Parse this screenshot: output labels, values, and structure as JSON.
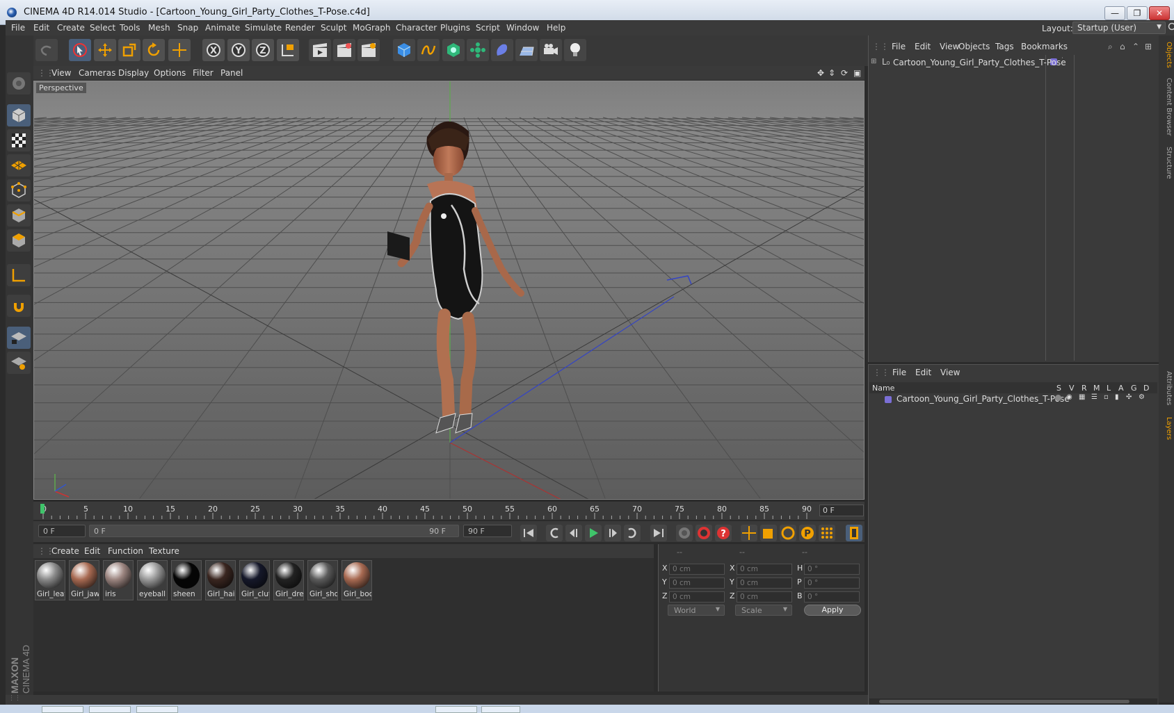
{
  "window": {
    "title": "CINEMA 4D R14.014 Studio - [Cartoon_Young_Girl_Party_Clothes_T-Pose.c4d]",
    "min_label": "—",
    "max_label": "❐",
    "close_label": "✕"
  },
  "menu": [
    "File",
    "Edit",
    "Create",
    "Select",
    "Tools",
    "Mesh",
    "Snap",
    "Animate",
    "Simulate",
    "Render",
    "Sculpt",
    "MoGraph",
    "Character",
    "Plugins",
    "Script",
    "Window",
    "Help"
  ],
  "layout": {
    "label": "Layout:",
    "value": "Startup (User)"
  },
  "viewport": {
    "menu": [
      "View",
      "Cameras",
      "Display",
      "Options",
      "Filter",
      "Panel"
    ],
    "label": "Perspective"
  },
  "timeline": {
    "ticks": [
      "0",
      "5",
      "10",
      "15",
      "20",
      "25",
      "30",
      "35",
      "40",
      "45",
      "50",
      "55",
      "60",
      "65",
      "70",
      "75",
      "80",
      "85",
      "90"
    ],
    "current": "0 F"
  },
  "transport": {
    "start": "0 F",
    "range_start": "0 F",
    "range_end": "90 F",
    "end": "90 F"
  },
  "materials": {
    "menu": [
      "Create",
      "Edit",
      "Function",
      "Texture"
    ],
    "items": [
      {
        "name": "Girl_leat",
        "color": "#8a8a8a"
      },
      {
        "name": "Girl_jaw",
        "color": "#a86a52"
      },
      {
        "name": "iris",
        "color": "#9c8580"
      },
      {
        "name": "eyeball",
        "color": "#9a9a9a"
      },
      {
        "name": "sheen",
        "color": "#050505"
      },
      {
        "name": "Girl_hair",
        "color": "#3a2620"
      },
      {
        "name": "Girl_clut",
        "color": "#15182a"
      },
      {
        "name": "Girl_dre",
        "color": "#222"
      },
      {
        "name": "Girl_sho",
        "color": "#5b5b5b"
      },
      {
        "name": "Girl_boc",
        "color": "#a86a52"
      }
    ]
  },
  "coords": {
    "headers": [
      "--",
      "--",
      "--"
    ],
    "rows": [
      {
        "a": "X",
        "av": "0 cm",
        "b": "X",
        "bv": "0 cm",
        "c": "H",
        "cv": "0 °"
      },
      {
        "a": "Y",
        "av": "0 cm",
        "b": "Y",
        "bv": "0 cm",
        "c": "P",
        "cv": "0 °"
      },
      {
        "a": "Z",
        "av": "0 cm",
        "b": "Z",
        "bv": "0 cm",
        "c": "B",
        "cv": "0 °"
      }
    ],
    "world": "World",
    "scale": "Scale",
    "apply": "Apply"
  },
  "objects": {
    "menu": [
      "File",
      "Edit",
      "View",
      "Objects",
      "Tags",
      "Bookmarks"
    ],
    "item": "Cartoon_Young_Girl_Party_Clothes_T-Pose"
  },
  "layers": {
    "menu": [
      "File",
      "Edit",
      "View"
    ],
    "name_header": "Name",
    "cols": [
      "S",
      "V",
      "R",
      "M",
      "L",
      "A",
      "G",
      "D"
    ],
    "item": "Cartoon_Young_Girl_Party_Clothes_T-Pose"
  },
  "sidetabs": [
    "Objects",
    "Content Browser",
    "Structure",
    "Attributes",
    "Layers"
  ],
  "brand": {
    "maxon": "MAXON",
    "product": "CINEMA 4D"
  },
  "colors": {
    "accent_orange": "#f0a000",
    "selection_blue": "#4a5f7a",
    "layer_purple": "#7b6fd6"
  }
}
